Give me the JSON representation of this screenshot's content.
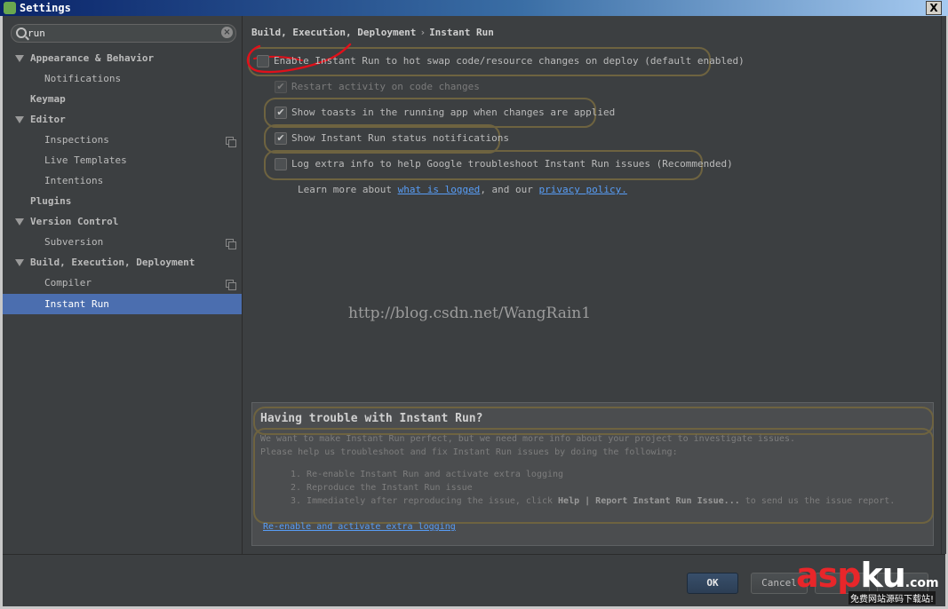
{
  "window": {
    "title": "Settings",
    "close_label": "X"
  },
  "sidebar": {
    "search": {
      "value": "run",
      "clear_label": "×"
    },
    "items": [
      {
        "label": "Appearance & Behavior"
      },
      {
        "label": "Notifications"
      },
      {
        "label": "Keymap"
      },
      {
        "label": "Editor"
      },
      {
        "label": "Inspections"
      },
      {
        "label": "Live Templates"
      },
      {
        "label": "Intentions"
      },
      {
        "label": "Plugins"
      },
      {
        "label": "Version Control"
      },
      {
        "label": "Subversion"
      },
      {
        "label": "Build, Execution, Deployment"
      },
      {
        "label": "Compiler"
      },
      {
        "label": "Instant Run"
      }
    ]
  },
  "main": {
    "breadcrumb": {
      "parent": "Build, Execution, Deployment",
      "separator": "›",
      "current": "Instant Run"
    },
    "options": [
      {
        "label": "Enable Instant Run to hot swap code/resource changes on deploy (default enabled)",
        "mark": ""
      },
      {
        "label": "Restart activity on code changes",
        "mark": "✔"
      },
      {
        "label": "Show toasts in the running app when changes are applied",
        "mark": "✔"
      },
      {
        "label": "Show Instant Run status notifications",
        "mark": "✔"
      },
      {
        "label": "Log extra info to help Google troubleshoot Instant Run issues (Recommended)",
        "mark": ""
      }
    ],
    "learn_more": {
      "prefix": "Learn more about ",
      "link1": "what is logged",
      "middle": ", and our ",
      "link2": "privacy policy."
    },
    "watermark": "http://blog.csdn.net/WangRain1"
  },
  "trouble": {
    "title": "Having trouble with Instant Run?",
    "line1": "We want to make Instant Run perfect, but we need more info about your project to investigate issues.",
    "line2": "Please help us troubleshoot and fix Instant Run issues by doing the following:",
    "step1": "1. Re-enable Instant Run and activate extra logging",
    "step2": "2. Reproduce the Instant Run issue",
    "step3_prefix": "3. Immediately after reproducing the issue, click ",
    "step3_bold": "Help | Report Instant Run Issue...",
    "step3_suffix": " to send us the issue report.",
    "link": "Re-enable and activate extra logging"
  },
  "buttons": {
    "ok": "OK",
    "cancel": "Cancel"
  },
  "brand": {
    "asp": "asp",
    "ku": "ku",
    "com": ".com",
    "sub": "免费网站源码下载站!"
  }
}
